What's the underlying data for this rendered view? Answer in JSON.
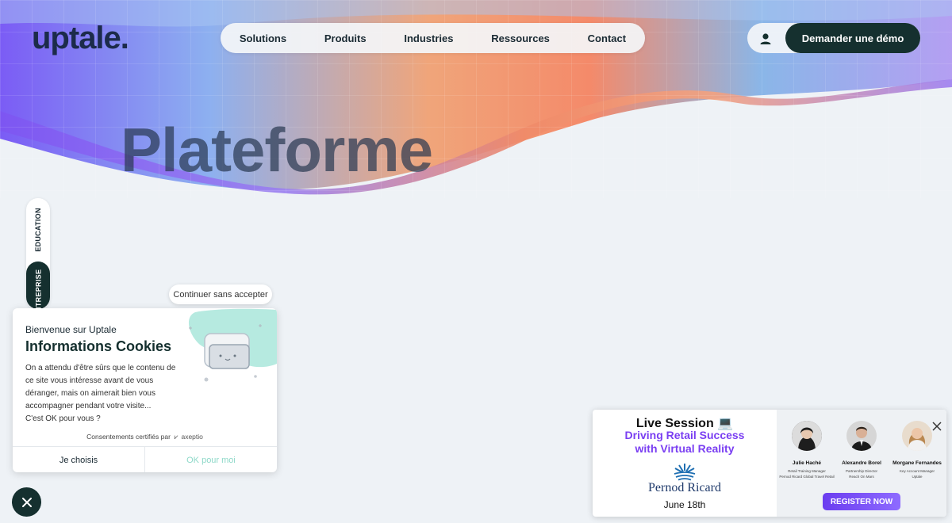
{
  "brand": {
    "logo_text": "uptale."
  },
  "nav": {
    "items": [
      "Solutions",
      "Produits",
      "Industries",
      "Ressources",
      "Contact"
    ]
  },
  "header": {
    "demo_label": "Demander une démo",
    "user_icon": "user-icon"
  },
  "hero": {
    "title": "Plateforme"
  },
  "segment": {
    "items": [
      "EDUCATION",
      "ENTREPRISE"
    ],
    "selected": "ENTREPRISE"
  },
  "cookie": {
    "continue_label": "Continuer sans accepter",
    "welcome": "Bienvenue sur Uptale",
    "title": "Informations Cookies",
    "body_lines": [
      "On a attendu d'être sûrs que le contenu de",
      "ce site vous intéresse avant de vous",
      "déranger, mais on aimerait bien vous",
      "accompagner pendant votre visite...",
      "C'est OK pour vous ?"
    ],
    "certified": "Consentements certifiés par",
    "certified_brand": "axeptio",
    "choose_label": "Je choisis",
    "ok_label": "OK pour moi"
  },
  "webinar": {
    "live": "Live Session 💻",
    "subtitle_1": "Driving Retail Success",
    "subtitle_2": "with Virtual Reality",
    "company": "Pernod Ricard",
    "date": "June 18th",
    "speakers": [
      {
        "name": "Julie Haché",
        "role_1": "Retail Training Manager",
        "role_2": "Pernod Ricard Global Travel Retail"
      },
      {
        "name": "Alexandre Borel",
        "role_1": "Partnership Director",
        "role_2": "Reach On Mars"
      },
      {
        "name": "Morgane Fernandes",
        "role_1": "Key Account Manager",
        "role_2": "Uptale"
      }
    ],
    "register_label": "REGISTER NOW"
  },
  "colors": {
    "accent_dark": "#15302f",
    "ok_green": "#8fd9c9",
    "webinar_purple": "#7a3ff2"
  }
}
